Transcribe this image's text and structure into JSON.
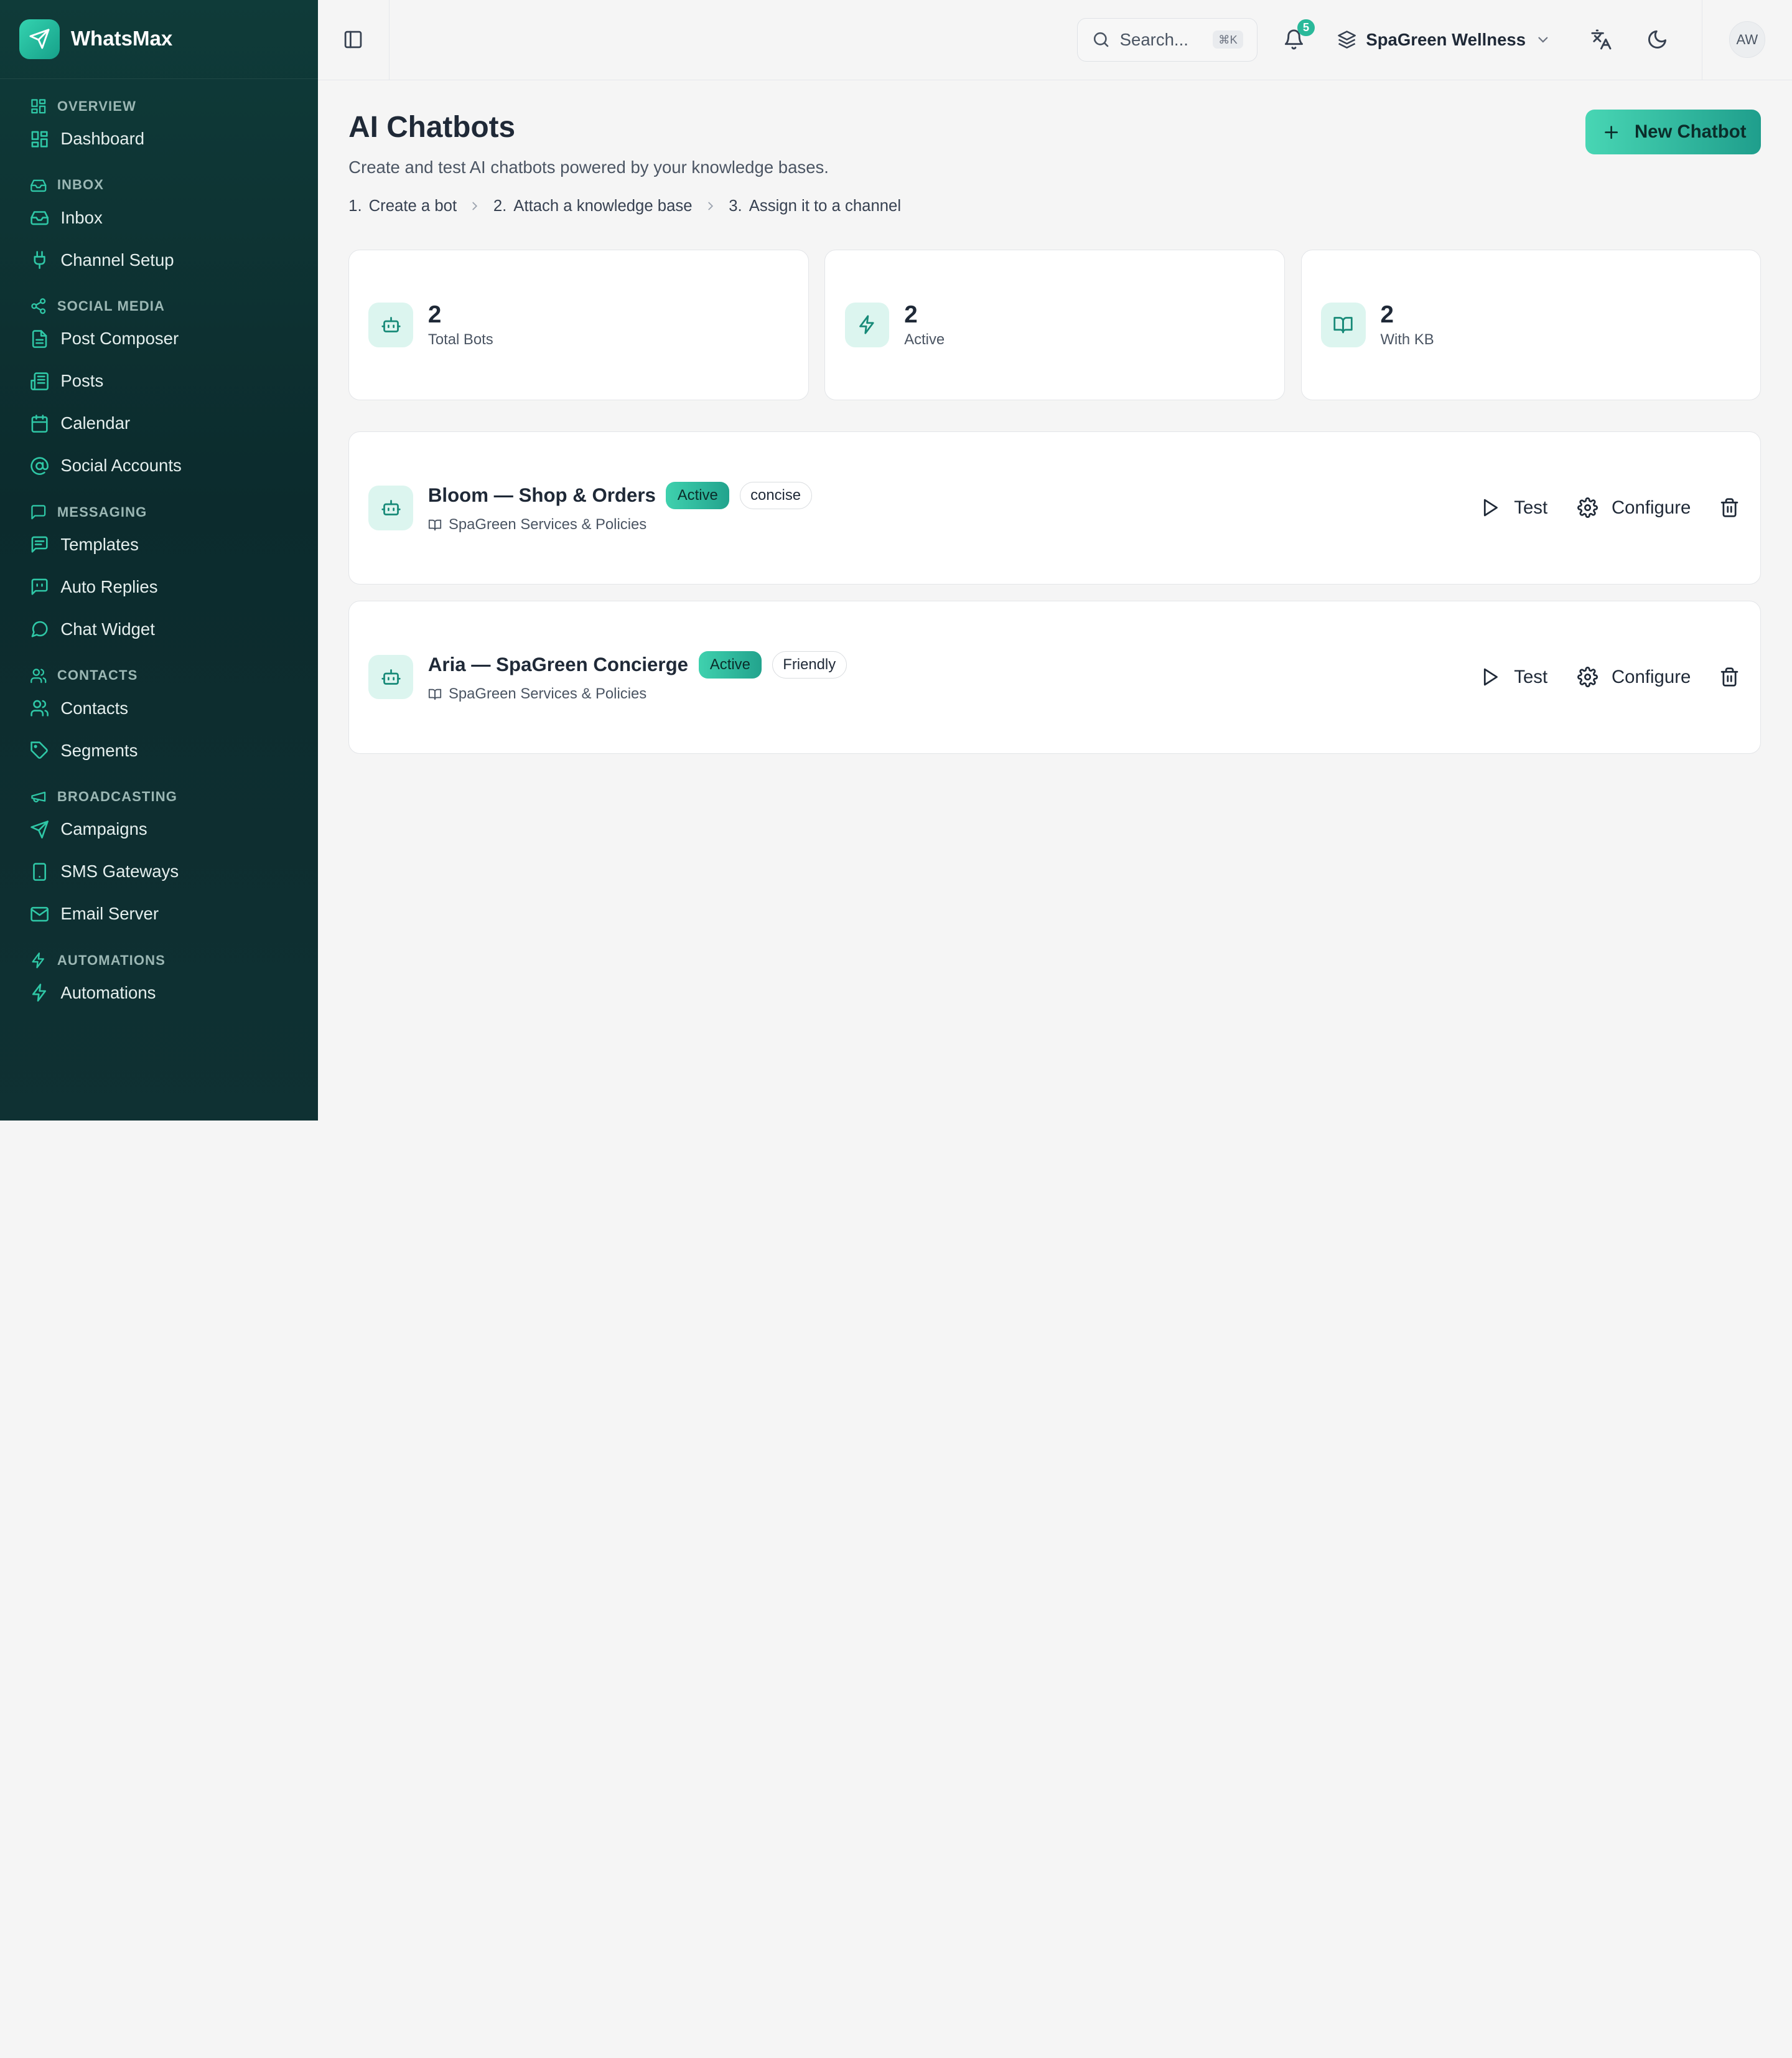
{
  "brand": {
    "name": "WhatsMax"
  },
  "sidebar": {
    "groups": [
      {
        "label": "OVERVIEW",
        "icon": "grid-icon",
        "items": [
          {
            "label": "Dashboard",
            "icon": "grid-icon"
          }
        ]
      },
      {
        "label": "INBOX",
        "icon": "inbox-icon",
        "items": [
          {
            "label": "Inbox",
            "icon": "inbox-icon"
          },
          {
            "label": "Channel Setup",
            "icon": "plug-icon"
          }
        ]
      },
      {
        "label": "SOCIAL MEDIA",
        "icon": "share-icon",
        "items": [
          {
            "label": "Post Composer",
            "icon": "file-icon"
          },
          {
            "label": "Posts",
            "icon": "newspaper-icon"
          },
          {
            "label": "Calendar",
            "icon": "calendar-icon"
          },
          {
            "label": "Social Accounts",
            "icon": "at-sign-icon"
          }
        ]
      },
      {
        "label": "MESSAGING",
        "icon": "message-square-icon",
        "items": [
          {
            "label": "Templates",
            "icon": "message-text-icon"
          },
          {
            "label": "Auto Replies",
            "icon": "bot-message-icon"
          },
          {
            "label": "Chat Widget",
            "icon": "message-circle-icon"
          }
        ]
      },
      {
        "label": "CONTACTS",
        "icon": "users-icon",
        "items": [
          {
            "label": "Contacts",
            "icon": "users-icon"
          },
          {
            "label": "Segments",
            "icon": "tag-icon"
          }
        ]
      },
      {
        "label": "BROADCASTING",
        "icon": "megaphone-icon",
        "items": [
          {
            "label": "Campaigns",
            "icon": "send-icon"
          },
          {
            "label": "SMS Gateways",
            "icon": "phone-icon"
          },
          {
            "label": "Email Server",
            "icon": "mail-icon"
          }
        ]
      },
      {
        "label": "AUTOMATIONS",
        "icon": "zap-icon",
        "items": [
          {
            "label": "Automations",
            "icon": "zap-icon"
          }
        ]
      }
    ]
  },
  "topbar": {
    "search_placeholder": "Search...",
    "search_shortcut": "⌘K",
    "notifications_count": "5",
    "workspace": "SpaGreen Wellness",
    "avatar_initials": "AW"
  },
  "page": {
    "title": "AI Chatbots",
    "subtitle": "Create and test AI chatbots powered by your knowledge bases.",
    "new_button": "New Chatbot",
    "steps": [
      {
        "num": "1.",
        "label": "Create a bot"
      },
      {
        "num": "2.",
        "label": "Attach a knowledge base"
      },
      {
        "num": "3.",
        "label": "Assign it to a channel"
      }
    ]
  },
  "stats": [
    {
      "value": "2",
      "label": "Total Bots",
      "icon": "bot-icon"
    },
    {
      "value": "2",
      "label": "Active",
      "icon": "zap-icon"
    },
    {
      "value": "2",
      "label": "With KB",
      "icon": "book-open-icon"
    }
  ],
  "bots": [
    {
      "name": "Bloom — Shop & Orders",
      "status": "Active",
      "tone": "concise",
      "kb": "SpaGreen Services & Policies",
      "test_label": "Test",
      "configure_label": "Configure"
    },
    {
      "name": "Aria — SpaGreen Concierge",
      "status": "Active",
      "tone": "Friendly",
      "kb": "SpaGreen Services & Policies",
      "test_label": "Test",
      "configure_label": "Configure"
    }
  ],
  "colors": {
    "accent": "#2ab99a",
    "sidebar_bg": "#0f3b39",
    "page_bg": "#f5f5f5"
  }
}
